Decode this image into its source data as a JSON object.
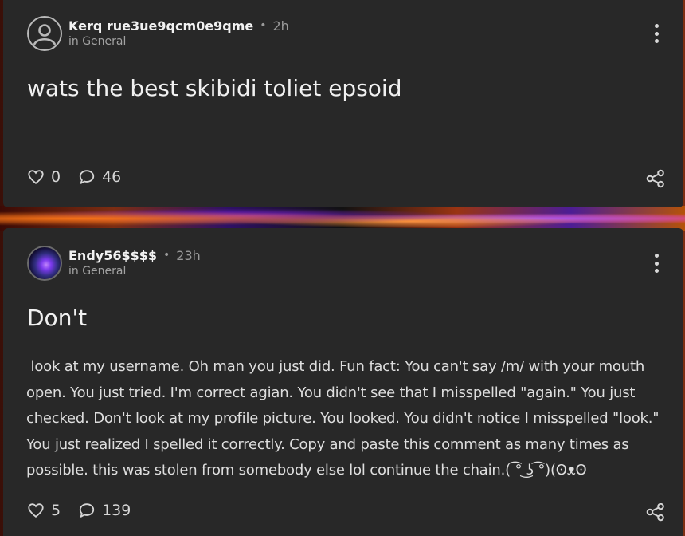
{
  "posts": [
    {
      "author": "Kerq rue3ue9qcm0e9qme",
      "time": "2h",
      "category": "in General",
      "title": "wats the best skibidi toliet epsoid",
      "body": "",
      "likes": "0",
      "comments": "46"
    },
    {
      "author": "Endy56$$$$",
      "time": "23h",
      "category": "in General",
      "title": "Don't",
      "body": " look at my username. Oh man you just did. Fun fact: You can't say /m/ with your mouth open. You just tried. I'm correct agian. You didn't see that I misspelled \"again.\" You just checked. Don't look at my profile picture. You looked. You didn't notice I misspelled \"look.\" You just realized I spelled it correctly. Copy and paste this comment as many times as possible. this was stolen from somebody else lol continue the chain.( ͡° ͜ʖ ͡°)(ʘᴥʘ",
      "likes": "5",
      "comments": "139"
    }
  ],
  "separator": "•",
  "icons": {
    "avatar_default": "user-circle-icon",
    "like": "heart-icon",
    "comment": "speech-bubble-icon",
    "share": "share-icon",
    "more": "kebab-menu-icon"
  },
  "colors": {
    "card_bg": "#282828",
    "text_primary": "#f1f1f1",
    "text_muted": "#9a9a9a"
  }
}
